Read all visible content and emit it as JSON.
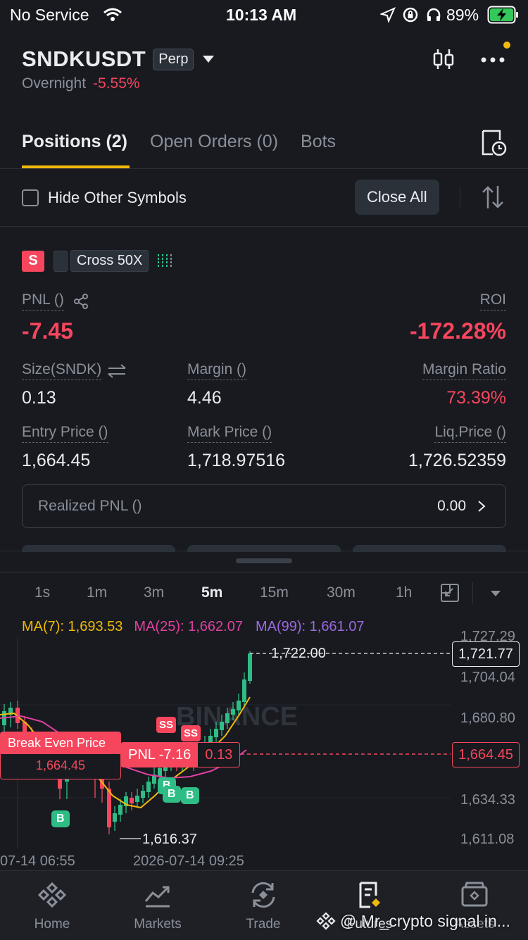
{
  "status_bar": {
    "carrier": "No Service",
    "time": "10:13 AM",
    "battery": "89%"
  },
  "header": {
    "symbol": "SNDKUSDT",
    "contract_type": "Perp",
    "session": "Overnight",
    "change": "-5.55%"
  },
  "tabs": [
    {
      "label": "Positions (2)"
    },
    {
      "label": "Open Orders (0)"
    },
    {
      "label": "Bots"
    }
  ],
  "filters": {
    "hide_other_label": "Hide Other Symbols",
    "close_all_label": "Close All"
  },
  "position": {
    "side_badge": "S",
    "margin_mode": "Cross 50X",
    "pnl_label": "PNL ()",
    "pnl_value": "-7.45",
    "roi_label": "ROI",
    "roi_value": "-172.28%",
    "size_label": "Size(SNDK)",
    "size_value": "0.13",
    "margin_label": "Margin ()",
    "margin_value": "4.46",
    "margin_ratio_label": "Margin Ratio",
    "margin_ratio_value": "73.39%",
    "entry_label": "Entry Price ()",
    "entry_value": "1,664.45",
    "mark_label": "Mark Price ()",
    "mark_value": "1,718.97516",
    "liq_label": "Liq.Price ()",
    "liq_value": "1,726.52359",
    "realized_label": "Realized PNL ()",
    "realized_value": "0.00"
  },
  "timeframes": [
    "1s",
    "1m",
    "3m",
    "5m",
    "15m",
    "30m",
    "1h"
  ],
  "active_timeframe": "5m",
  "indicators": {
    "ma7": "MA(7): 1,693.53",
    "ma25": "MA(25): 1,662.07",
    "ma99": "MA(99): 1,661.07",
    "ma7_color": "#f0b90b",
    "ma25_color": "#e040a0",
    "ma99_color": "#9c6ade"
  },
  "chart": {
    "price_axis": [
      "1,727.29",
      "1,704.04",
      "1,680.80",
      "1,634.33",
      "1,611.08"
    ],
    "current_price": "1,721.77",
    "entry_marker": "1,664.45",
    "high_label": "1,722.00",
    "low_label": "1,616.37",
    "time_labels": [
      "07-14 06:55",
      "2026-07-14 09:25"
    ],
    "break_even_label": "Break Even Price",
    "break_even_value": "1,664.45",
    "pnl_tag": "PNL -7.16",
    "size_tag": "0.13",
    "watermark": "BINANCE",
    "trade_markers": {
      "sell": "SS",
      "buy": "B"
    }
  },
  "bottom_nav": [
    {
      "label": "Home",
      "icon": "binance-logo-icon"
    },
    {
      "label": "Markets",
      "icon": "chart-line-icon"
    },
    {
      "label": "Trade",
      "icon": "trade-exchange-icon"
    },
    {
      "label": "Futures",
      "icon": "futures-doc-icon"
    },
    {
      "label": "Assets",
      "icon": "wallet-icon"
    }
  ],
  "overlay": {
    "watermark_text": "@ Mr_crypto signal in..."
  },
  "colors": {
    "background": "#181a20",
    "up": "#2ebd85",
    "down": "#f6465d",
    "accent": "#f0b90b"
  }
}
